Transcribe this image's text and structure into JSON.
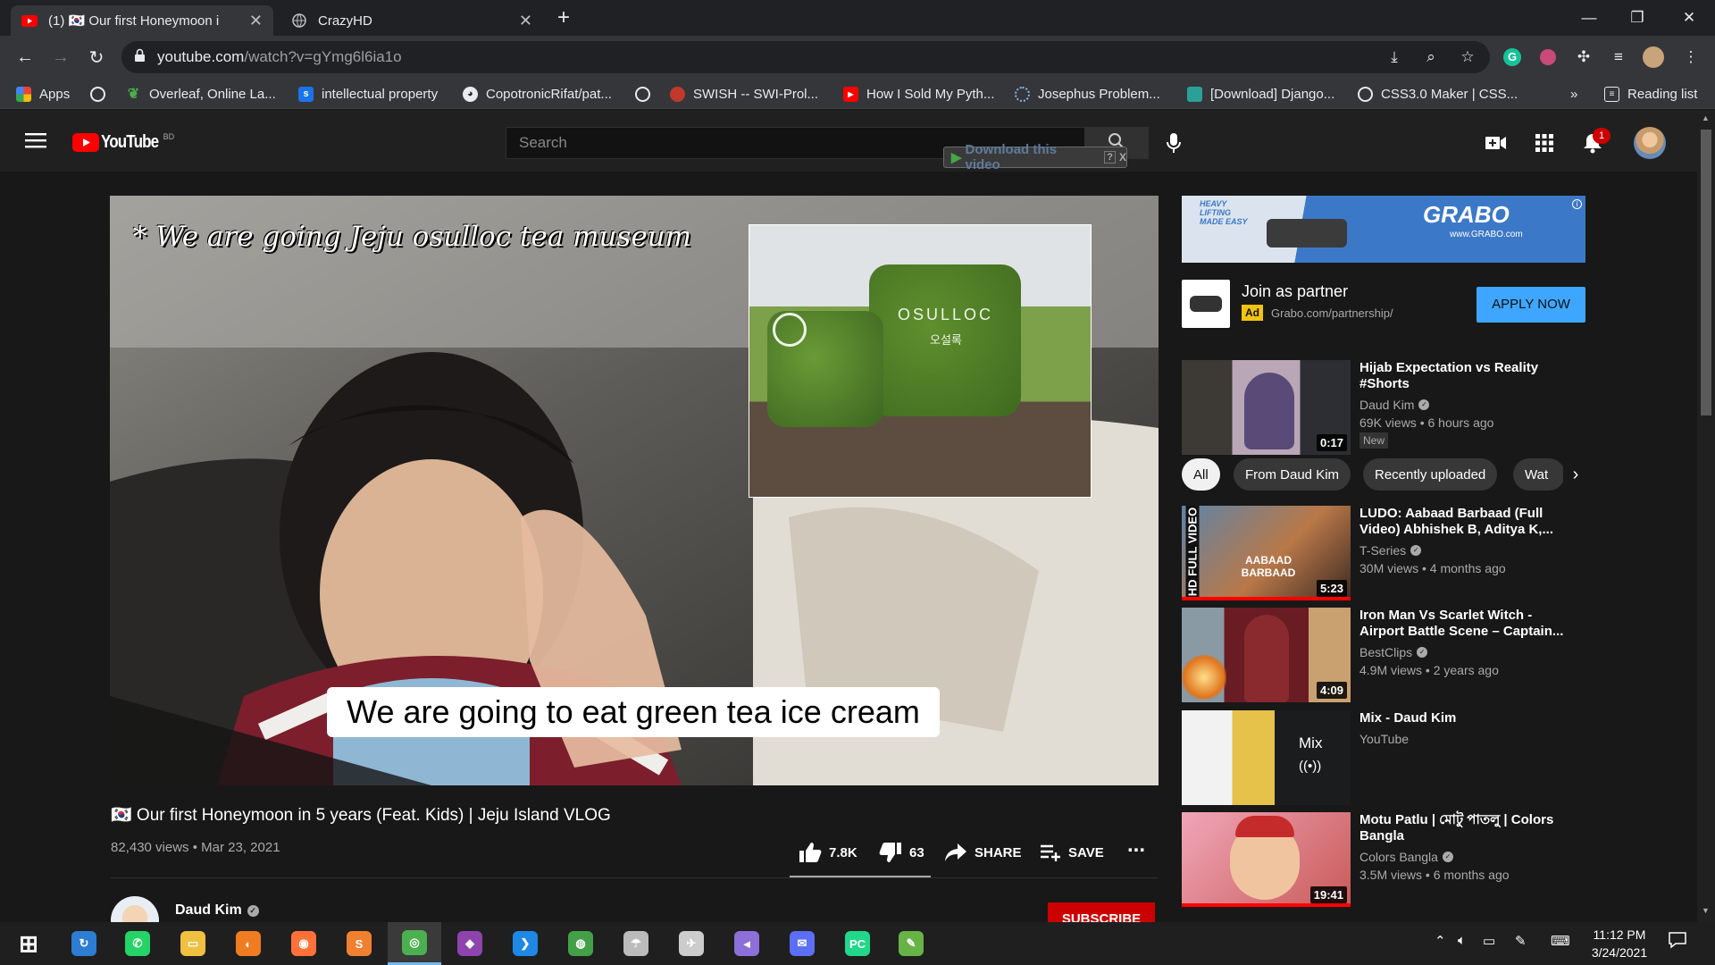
{
  "browser": {
    "tabs": [
      {
        "title": "(1) 🇰🇷 Our first Honeymoon i",
        "favicon": "youtube-icon"
      },
      {
        "title": "CrazyHD",
        "favicon": "globe-icon"
      }
    ],
    "new_tab": "+",
    "url_host": "youtube.com",
    "url_path": "/watch?v=gYmg6l6ia1o",
    "bookmarks": [
      {
        "label": "Apps",
        "icon": "apps-grid-icon"
      },
      {
        "label": "",
        "icon": "globe-icon"
      },
      {
        "label": "Overleaf, Online La...",
        "icon": "overleaf-icon"
      },
      {
        "label": "intellectual property",
        "icon": "s-icon"
      },
      {
        "label": "CopotronicRifat/pat...",
        "icon": "github-icon"
      },
      {
        "label": "",
        "icon": "globe-icon"
      },
      {
        "label": "SWISH -- SWI-Prol...",
        "icon": "swish-icon"
      },
      {
        "label": "How I Sold My Pyth...",
        "icon": "youtube-icon"
      },
      {
        "label": "Josephus Problem...",
        "icon": "loading-icon"
      },
      {
        "label": "[Download] Django...",
        "icon": "django-icon"
      },
      {
        "label": "CSS3.0 Maker | CSS...",
        "icon": "globe-icon"
      }
    ],
    "more_bookmarks": "»",
    "reading_list": "Reading list"
  },
  "youtube": {
    "logo_text": "YouTube",
    "region": "BD",
    "search_placeholder": "Search",
    "download_bar": "Download this video",
    "download_help": "?",
    "download_close": "X",
    "notification_count": "1"
  },
  "video": {
    "overlay_handwritten": "* We are going Jeju osulloc tea museum",
    "caption": "We are going to eat green tea ice cream",
    "inset_sign": "OSULLOC",
    "inset_sign_korean": "오설록",
    "title": "🇰🇷 Our first Honeymoon in 5 years (Feat. Kids) | Jeju Island VLOG",
    "views": "82,430 views",
    "date": "Mar 23, 2021",
    "likes": "7.8K",
    "dislikes": "63",
    "share": "SHARE",
    "save": "SAVE",
    "more": "...",
    "channel": "Daud Kim",
    "subscribe": "SUBSCRIBE"
  },
  "ad": {
    "banner_brand": "GRABO",
    "banner_tag": "HEAVY LIFTING MADE EASY",
    "banner_url": "www.GRABO.com",
    "title": "Join as partner",
    "badge": "Ad",
    "url": "Grabo.com/partnership/",
    "cta": "APPLY NOW"
  },
  "chips": [
    "All",
    "From Daud Kim",
    "Recently uploaded",
    "Wat"
  ],
  "sidebar": [
    {
      "title": "Hijab Expectation vs Reality #Shorts",
      "channel": "Daud Kim",
      "verified": true,
      "meta": "69K views • 6 hours ago",
      "badge": "New",
      "duration": "0:17",
      "thumb_color": "#5c4a3c"
    },
    {
      "title": "LUDO: Aabaad Barbaad (Full Video) Abhishek B, Aditya K,...",
      "channel": "T-Series",
      "verified": true,
      "meta": "30M views • 4 months ago",
      "duration": "5:23",
      "thumb_color": "#7a4a2e",
      "thumb_text": "AABAAD BARBAAD",
      "side_text": "HD FULL VIDEO"
    },
    {
      "title": "Iron Man Vs Scarlet Witch - Airport Battle Scene – Captain...",
      "channel": "BestClips",
      "verified": true,
      "meta": "4.9M views • 2 years ago",
      "duration": "4:09",
      "thumb_color": "#6b2a2a"
    },
    {
      "title": "Mix - Daud Kim",
      "channel": "YouTube",
      "verified": false,
      "meta": "",
      "duration": "",
      "thumb_color": "#3a3f4a",
      "mix_label": "Mix",
      "mix_icon": "((•))"
    },
    {
      "title": "Motu Patlu | মোটু পাতলু | Colors Bangla",
      "channel": "Colors Bangla",
      "verified": true,
      "meta": "3.5M views • 6 months ago",
      "duration": "19:41",
      "thumb_color": "#b8463a"
    }
  ],
  "taskbar": {
    "time": "11:12 PM",
    "date": "3/24/2021",
    "apps": [
      {
        "name": "windows-start-icon",
        "color": "#ffffff",
        "glyph": "⊞"
      },
      {
        "name": "sync-icon",
        "color": "#2d7dd2",
        "glyph": "↻"
      },
      {
        "name": "whatsapp-icon",
        "color": "#25d366",
        "glyph": "✆"
      },
      {
        "name": "file-explorer-icon",
        "color": "#f0c040",
        "glyph": "▭"
      },
      {
        "name": "avast-icon",
        "color": "#f07c22",
        "glyph": "◐"
      },
      {
        "name": "firefox-icon",
        "color": "#ff7139",
        "glyph": "◉"
      },
      {
        "name": "sublime-icon",
        "color": "#f08030",
        "glyph": "S"
      },
      {
        "name": "chrome-icon",
        "color": "#4caf50",
        "glyph": "◎"
      },
      {
        "name": "github-desktop-icon",
        "color": "#8e44ad",
        "glyph": "◆"
      },
      {
        "name": "vscode-icon",
        "color": "#1e88e5",
        "glyph": "❯"
      },
      {
        "name": "earth-icon",
        "color": "#43a047",
        "glyph": "◍"
      },
      {
        "name": "eclipse-icon",
        "color": "#bbbbbb",
        "glyph": "☂"
      },
      {
        "name": "satellite-icon",
        "color": "#cccccc",
        "glyph": "✈"
      },
      {
        "name": "visual-studio-icon",
        "color": "#8c6fd8",
        "glyph": "◄"
      },
      {
        "name": "messenger-icon",
        "color": "#5b6ef5",
        "glyph": "✉"
      },
      {
        "name": "pycharm-icon",
        "color": "#21d789",
        "glyph": "PC"
      },
      {
        "name": "notepad-icon",
        "color": "#67b346",
        "glyph": "✎"
      }
    ]
  },
  "colors": {
    "yt_red": "#ff0000",
    "apply_blue": "#3ea6ff",
    "ad_yellow": "#f1c40f"
  }
}
